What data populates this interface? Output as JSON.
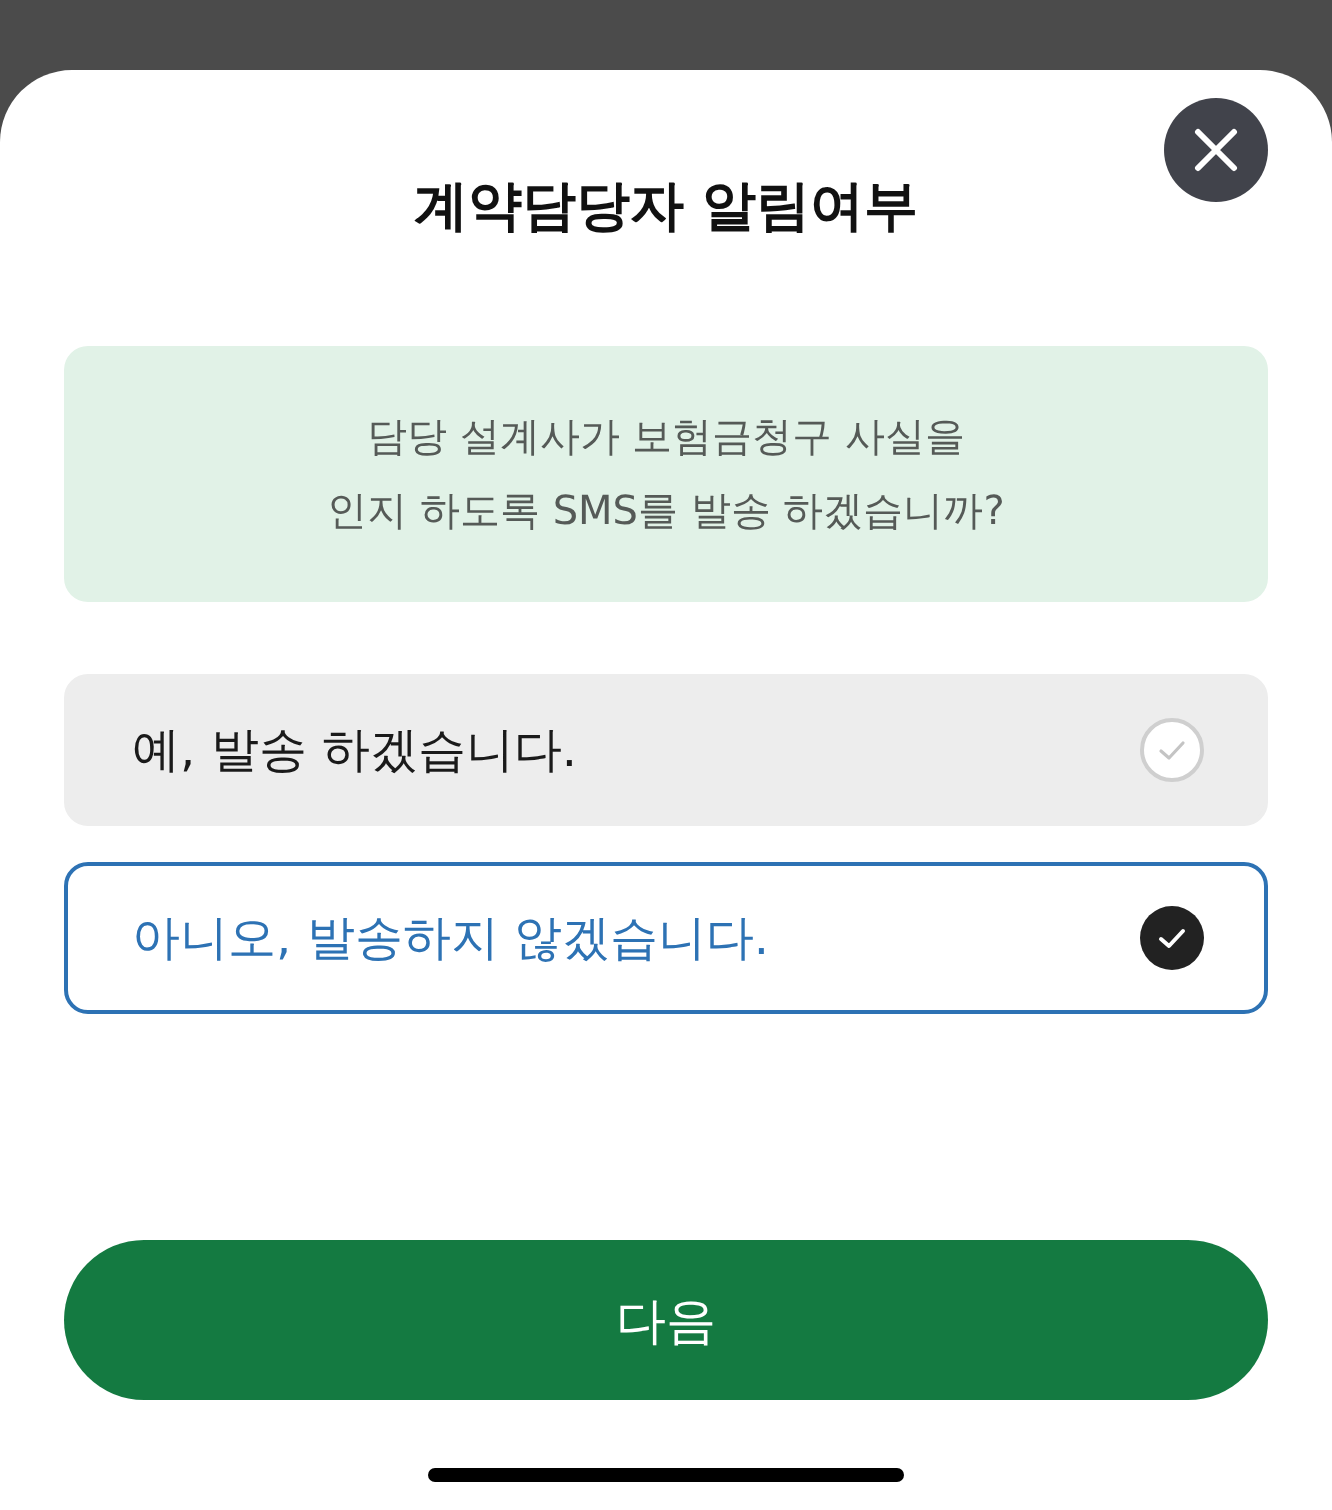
{
  "title": "계약담당자 알림여부",
  "message": "담당 설계사가 보험금청구 사실을\n인지 하도록 SMS를 발송 하겠습니까?",
  "options": [
    {
      "label": "예, 발송 하겠습니다.",
      "selected": false
    },
    {
      "label": "아니오, 발송하지 않겠습니다.",
      "selected": true
    }
  ],
  "next_button": {
    "label": "다음"
  }
}
